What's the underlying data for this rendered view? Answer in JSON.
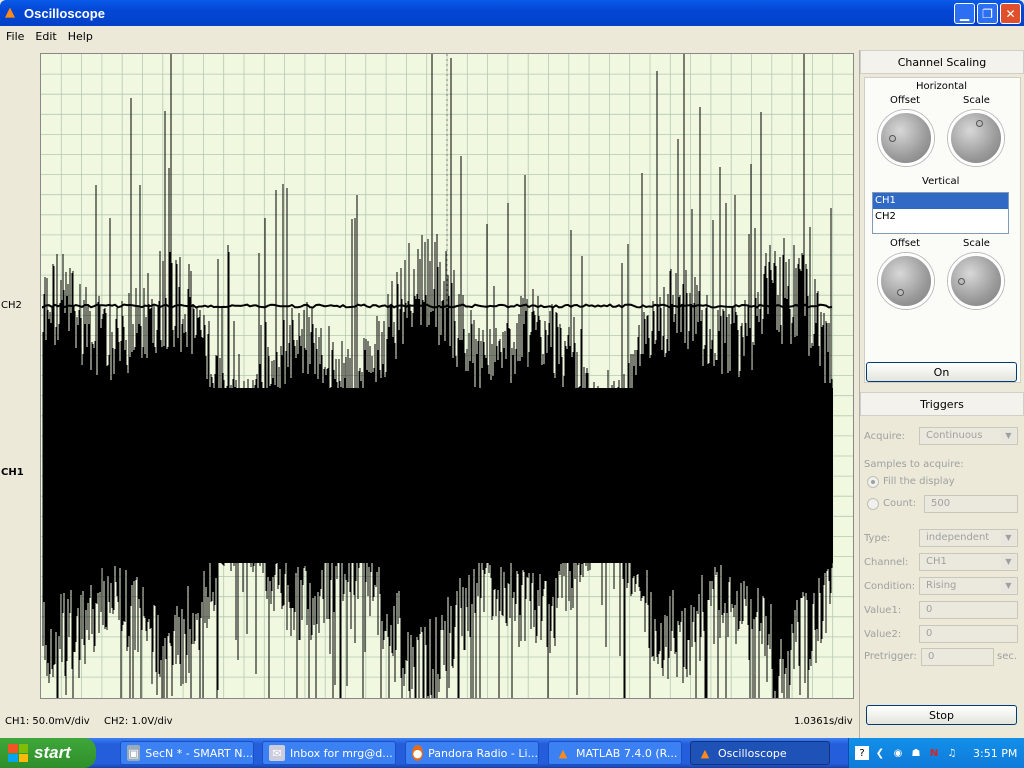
{
  "window": {
    "title": "Oscilloscope"
  },
  "menu": [
    "File",
    "Edit",
    "Help"
  ],
  "display": {
    "ch2_marker": "CH2",
    "ch1_marker": "CH1",
    "ch1_scale": "CH1: 50.0mV/div",
    "ch2_scale": "CH2: 1.0V/div",
    "time_scale": "1.0361s/div",
    "background_color": "#f0f8e0",
    "trace_color": "#000000"
  },
  "panel": {
    "channel_scaling_title": "Channel Scaling",
    "horizontal_label": "Horizontal",
    "h_offset_label": "Offset",
    "h_scale_label": "Scale",
    "vertical_label": "Vertical",
    "channels": [
      "CH1",
      "CH2"
    ],
    "selected_channel": "CH1",
    "v_offset_label": "Offset",
    "v_scale_label": "Scale",
    "on_button": "On",
    "triggers_title": "Triggers",
    "acquire_label": "Acquire:",
    "acquire_value": "Continuous",
    "samples_label": "Samples to acquire:",
    "fill_display_label": "Fill the display",
    "count_label": "Count:",
    "count_value": "500",
    "type_label": "Type:",
    "type_value": "independent",
    "channel_label": "Channel:",
    "channel_value": "CH1",
    "condition_label": "Condition:",
    "condition_value": "Rising",
    "value1_label": "Value1:",
    "value1_value": "0",
    "value2_label": "Value2:",
    "value2_value": "0",
    "pretrigger_label": "Pretrigger:",
    "pretrigger_value": "0",
    "pretrigger_unit": "sec.",
    "stop_button": "Stop"
  },
  "taskbar": {
    "start_label": "start",
    "tasks": [
      "SecN * - SMART N...",
      "Inbox for mrg@d...",
      "Pandora Radio - Li...",
      "MATLAB 7.4.0 (R...",
      "Oscilloscope"
    ],
    "active_task": "Oscilloscope",
    "clock": "3:51 PM"
  }
}
